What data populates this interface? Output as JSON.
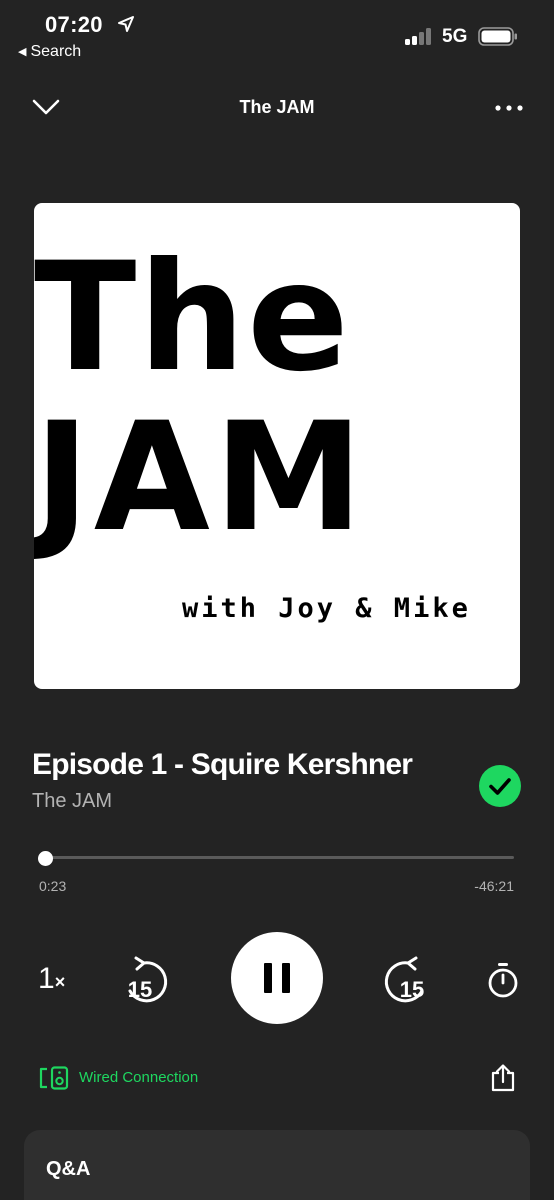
{
  "status_bar": {
    "time": "07:20",
    "back_label": "Search",
    "network": "5G"
  },
  "header": {
    "title": "The JAM"
  },
  "cover": {
    "line1": "The",
    "line2": "JAM",
    "line3": "with Joy & Mike"
  },
  "episode": {
    "title": "Episode 1 - Squire Kershner",
    "show": "The JAM",
    "downloaded": true
  },
  "progress": {
    "elapsed": "0:23",
    "remaining": "-46:21",
    "fraction": 0.008
  },
  "controls": {
    "speed_value": "1",
    "speed_suffix": "×",
    "skip_back_seconds": "15",
    "skip_forward_seconds": "15",
    "state": "playing"
  },
  "device": {
    "label": "Wired Connection"
  },
  "qa": {
    "title": "Q&A"
  },
  "colors": {
    "background": "#232323",
    "accent": "#1ed760",
    "secondary_text": "#b3b3b3"
  }
}
